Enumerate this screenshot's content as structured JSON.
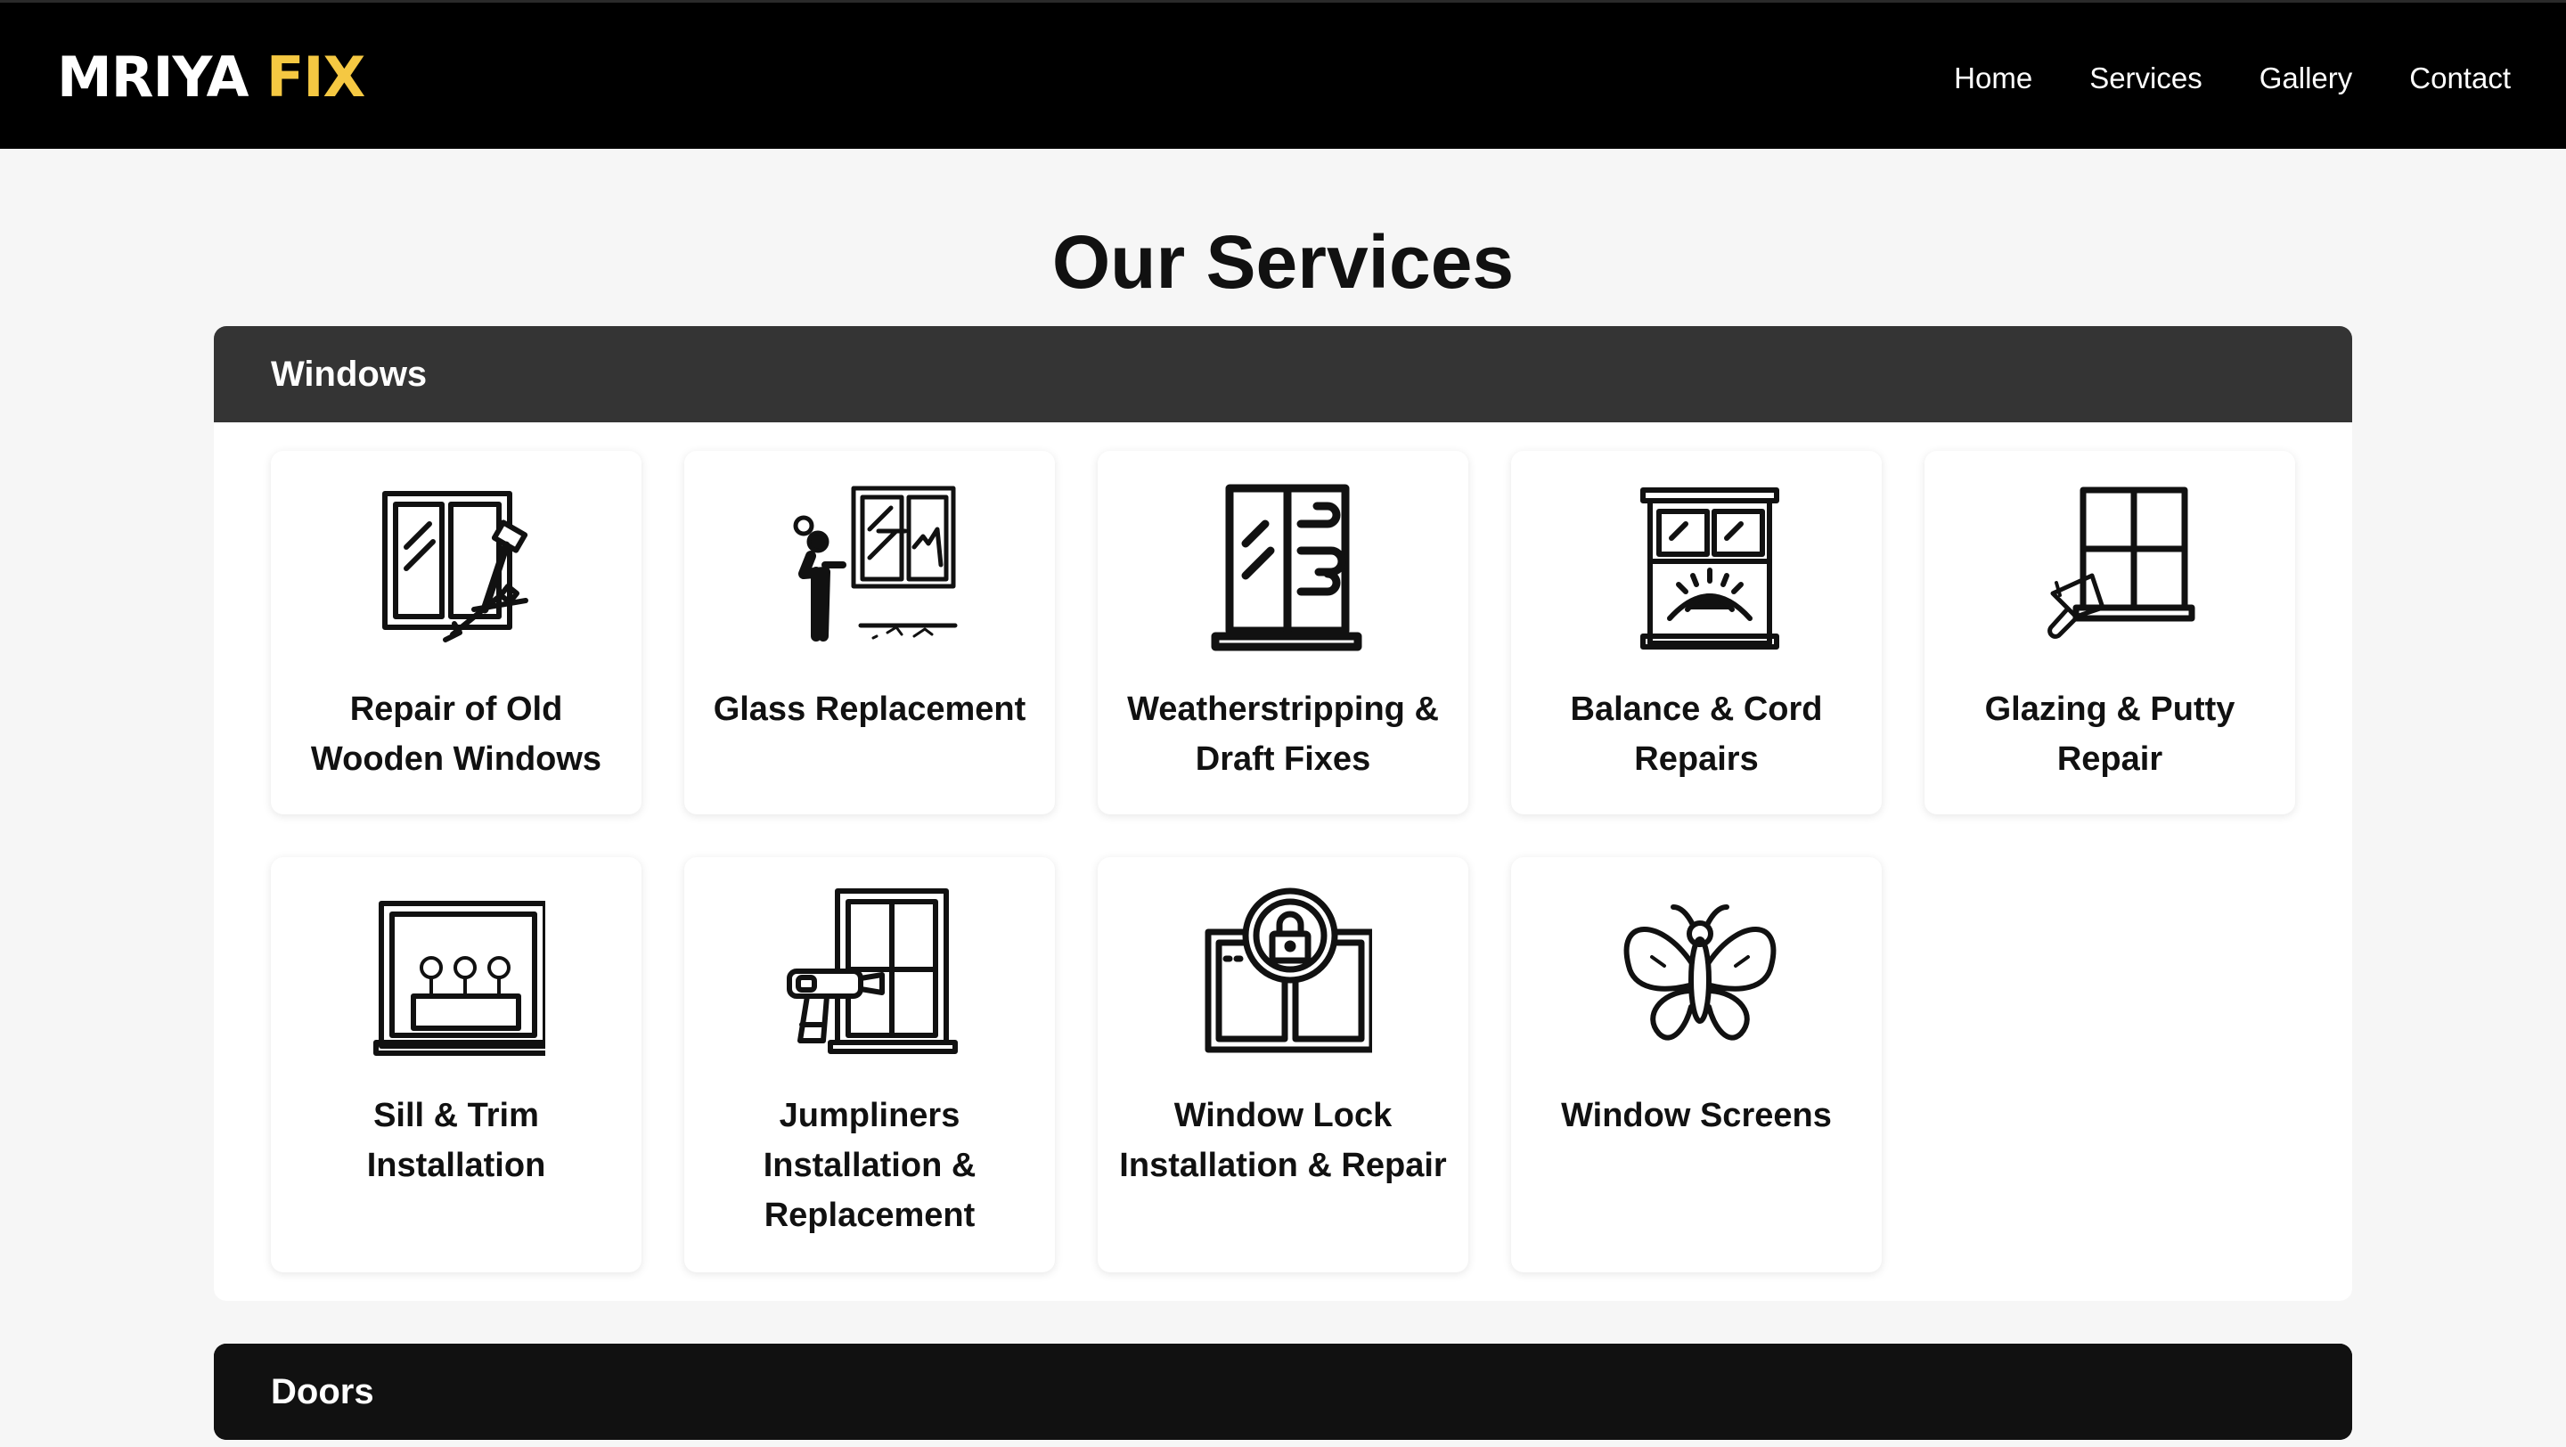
{
  "brand": {
    "name_part1": "MRIYA",
    "name_part2": "FIX",
    "accent_color": "#f5c842"
  },
  "nav": {
    "items": [
      "Home",
      "Services",
      "Gallery",
      "Contact"
    ]
  },
  "page_title": "Our Services",
  "sections": [
    {
      "title": "Windows",
      "cards": [
        {
          "label": "Repair of Old Wooden Windows",
          "icon": "window-hammer-wrench-icon"
        },
        {
          "label": "Glass Replacement",
          "icon": "person-broken-window-icon"
        },
        {
          "label": "Weatherstripping & Draft Fixes",
          "icon": "window-wind-icon"
        },
        {
          "label": "Balance & Cord Repairs",
          "icon": "window-sunrise-icon"
        },
        {
          "label": "Glazing & Putty Repair",
          "icon": "window-paintbrush-icon"
        },
        {
          "label": "Sill & Trim Installation",
          "icon": "window-flowerbox-icon"
        },
        {
          "label": "Jumpliners Installation & Replacement",
          "icon": "window-drill-icon"
        },
        {
          "label": "Window Lock Installation & Repair",
          "icon": "window-lock-icon"
        },
        {
          "label": "Window Screens",
          "icon": "butterfly-icon"
        }
      ]
    },
    {
      "title": "Doors"
    }
  ]
}
